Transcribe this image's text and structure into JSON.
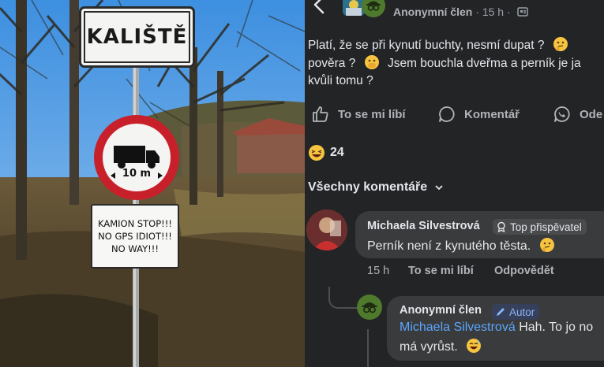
{
  "photo": {
    "place_sign": "KALIŠTĚ",
    "length_sign": "10 m",
    "warning_lines": [
      "KAMION STOP!!!",
      "NO GPS IDIOT!!!",
      "NO WAY!!!"
    ]
  },
  "post": {
    "author": "Anonymní člen",
    "time": "15 h",
    "separator": "·",
    "text_lines": [
      "Platí, že se při kynutí buchty, nesmí dupat ?",
      "pověra ?",
      "Jsem bouchla dveřma a perník je ja",
      "kvůli tomu ?"
    ],
    "actions": {
      "like": "To se mi líbí",
      "comment": "Komentář",
      "share": "Ode"
    },
    "reaction_count": "24",
    "sort_label": "Všechny komentáře"
  },
  "comments": [
    {
      "author": "Michaela Silvestrová",
      "badge": "Top přispěvatel",
      "text": "Perník není z kynutého těsta.",
      "time": "15 h",
      "like_label": "To se mi líbí",
      "reply_label": "Odpovědět"
    },
    {
      "author": "Anonymní člen",
      "badge": "Autor",
      "mention": "Michaela Silvestrová",
      "text_line1": "Hah. To jo no",
      "text_line2": "má vyrůst."
    }
  ],
  "colors": {
    "background": "#232426",
    "bubble": "#3a3b3c",
    "text": "#e4e6eb",
    "muted": "#b0b3b8",
    "mention": "#5aa7ff",
    "sign_red": "#c8202b"
  },
  "icons": [
    "back-arrow-icon",
    "globe-icon",
    "like-icon",
    "comment-icon",
    "share-icon",
    "laughing-emoji-icon",
    "chevron-down-icon",
    "top-contributor-icon",
    "author-pen-icon",
    "anonymous-icon"
  ]
}
